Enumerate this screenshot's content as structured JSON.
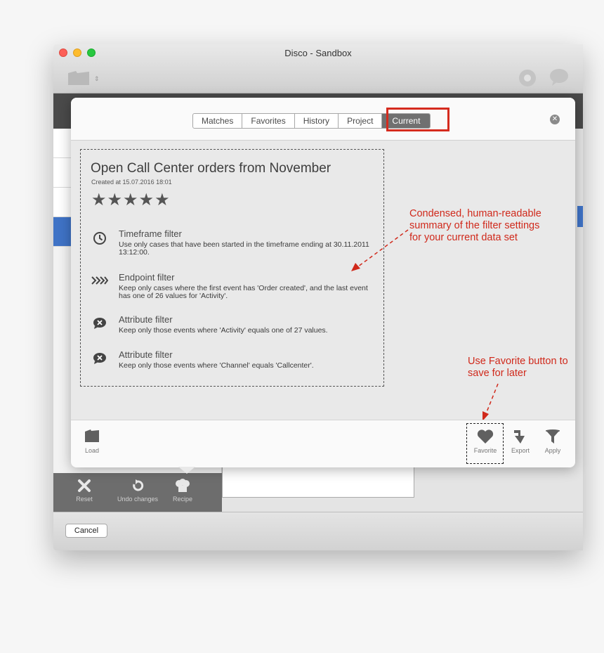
{
  "window": {
    "title": "Disco - Sandbox"
  },
  "toolbar": {
    "updown": "⇕"
  },
  "popover": {
    "tabs": [
      {
        "label": "Matches",
        "active": false
      },
      {
        "label": "Favorites",
        "active": false
      },
      {
        "label": "History",
        "active": false
      },
      {
        "label": "Project",
        "active": false
      },
      {
        "label": "Current",
        "active": true
      }
    ],
    "close_glyph": "✕",
    "recipe": {
      "title": "Open Call Center orders from November",
      "created_at": "Created at 15.07.2016 18:01",
      "stars": "★★★★★",
      "rating": 5,
      "filters": [
        {
          "name": "Timeframe filter",
          "icon": "clock-icon",
          "description": "Use only cases that have been started in the timeframe ending at 30.11.2011 13:12:00."
        },
        {
          "name": "Endpoint filter",
          "icon": "endpoint-chevrons-icon",
          "description": "Keep only cases where the first event has 'Order created', and the last event has one of 26 values for 'Activity'."
        },
        {
          "name": "Attribute filter",
          "icon": "attribute-bubble-icon",
          "description": "Keep only those events where 'Activity' equals one of 27 values."
        },
        {
          "name": "Attribute filter",
          "icon": "attribute-bubble-icon",
          "description": "Keep only those events where 'Channel' equals 'Callcenter'."
        }
      ]
    },
    "annotations": {
      "summary": "Condensed, human-readable summary of the filter settings for your current data set",
      "favorite": "Use Favorite button to save for later"
    },
    "footer": {
      "load": "Load",
      "favorite": "Favorite",
      "export": "Export",
      "apply": "Apply"
    }
  },
  "bottom_tools": {
    "reset": "Reset",
    "undo": "Undo changes",
    "recipe": "Recipe"
  },
  "cancel": "Cancel",
  "colors": {
    "accent_blue": "#3f73c6",
    "annotation_red": "#d0291b",
    "active_tab": "#707070"
  }
}
